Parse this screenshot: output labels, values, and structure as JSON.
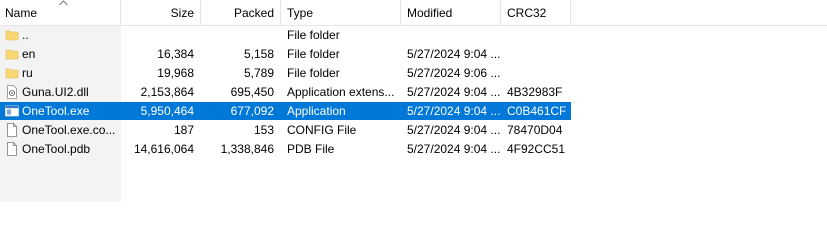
{
  "columns": {
    "name": "Name",
    "size": "Size",
    "packed": "Packed",
    "type": "Type",
    "modified": "Modified",
    "crc32": "CRC32"
  },
  "rows": [
    {
      "icon": "folder-up-icon",
      "name": "..",
      "size": "",
      "packed": "",
      "type": "File folder",
      "modified": "",
      "crc32": "",
      "selected": false
    },
    {
      "icon": "folder-icon",
      "name": "en",
      "size": "16,384",
      "packed": "5,158",
      "type": "File folder",
      "modified": "5/27/2024 9:04 ...",
      "crc32": "",
      "selected": false
    },
    {
      "icon": "folder-icon",
      "name": "ru",
      "size": "19,968",
      "packed": "5,789",
      "type": "File folder",
      "modified": "5/27/2024 9:06 ...",
      "crc32": "",
      "selected": false
    },
    {
      "icon": "dll-file-icon",
      "name": "Guna.UI2.dll",
      "size": "2,153,864",
      "packed": "695,450",
      "type": "Application extens...",
      "modified": "5/27/2024 9:04 ...",
      "crc32": "4B32983F",
      "selected": false
    },
    {
      "icon": "exe-file-icon",
      "name": "OneTool.exe",
      "size": "5,950,464",
      "packed": "677,092",
      "type": "Application",
      "modified": "5/27/2024 9:04 ...",
      "crc32": "C0B461CF",
      "selected": true
    },
    {
      "icon": "file-icon",
      "name": "OneTool.exe.co...",
      "size": "187",
      "packed": "153",
      "type": "CONFIG File",
      "modified": "5/27/2024 9:04 ...",
      "crc32": "78470D04",
      "selected": false
    },
    {
      "icon": "file-icon",
      "name": "OneTool.pdb",
      "size": "14,616,064",
      "packed": "1,338,846",
      "type": "PDB File",
      "modified": "5/27/2024 9:04 ...",
      "crc32": "4F92CC51",
      "selected": false
    }
  ],
  "colors": {
    "selection": "#0078d7",
    "folder": "#f8d775",
    "header_border": "#e5e5e5"
  }
}
